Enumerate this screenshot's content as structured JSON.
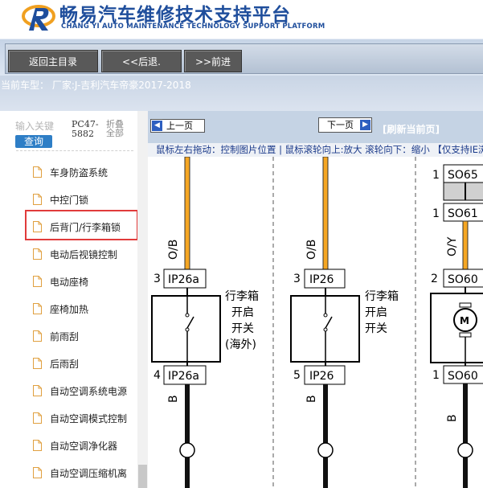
{
  "header": {
    "title": "畅易汽车维修技术支持平台",
    "subtitle": "CHANG YI AUTO MAINTENANCE TECHNOLOGY SUPPORT PLATFORM"
  },
  "toolbar": {
    "back_main": "返回主目录",
    "back": "<<后退.",
    "forward": ">>前进"
  },
  "car_line": "当前车型： 厂家:J-吉利汽车帝豪2017-2018",
  "sidebar": {
    "keyword_placeholder": "输入关键",
    "search_btn": "查询",
    "pc_code": "PC47-5882",
    "fold_all": "折叠全部",
    "items": [
      {
        "label": "车身防盗系统"
      },
      {
        "label": "中控门锁"
      },
      {
        "label": "后背门/行李箱锁"
      },
      {
        "label": "电动后视镜控制"
      },
      {
        "label": "电动座椅"
      },
      {
        "label": "座椅加热"
      },
      {
        "label": "前雨刮"
      },
      {
        "label": "后雨刮"
      },
      {
        "label": "自动空调系统电源"
      },
      {
        "label": "自动空调模式控制"
      },
      {
        "label": "自动空调净化器"
      },
      {
        "label": "自动空调压缩机离"
      }
    ]
  },
  "viewer": {
    "prev_page": "上一页",
    "next_page": "下一页",
    "refresh": "[刷新当前页]",
    "help": "鼠标左右拖动：控制图片位置 | 鼠标滚轮向上:放大  滚轮向下：缩小 【仅支持IE浏览器】"
  },
  "diagram": {
    "c1": {
      "wire_top": "O/B",
      "pin_top": "3",
      "conn_top": "IP26a",
      "pin_bot": "4",
      "conn_bot": "IP26a",
      "wire_bot": "B",
      "switch_label": [
        "行李箱",
        "开启",
        "开关",
        "(海外)"
      ]
    },
    "c2": {
      "wire_top": "O/B",
      "pin_top": "3",
      "conn_top": "IP26",
      "pin_bot": "5",
      "conn_bot": "IP26",
      "wire_bot": "B",
      "switch_label": [
        "行李箱",
        "开启",
        "开关"
      ]
    },
    "c3": {
      "pin_a": "1",
      "conn_a": "SO65",
      "pin_b": "1",
      "conn_b": "SO61",
      "wire_mid": "O/Y",
      "pin_c": "2",
      "conn_c": "SO60",
      "pin_d": "1",
      "conn_d": "SO60",
      "wire_bot": "B",
      "motor": "M"
    }
  },
  "colors": {
    "brand": "#1f4e9c",
    "highlight": "#e13b3b",
    "wire_orange": "#f5a623"
  }
}
